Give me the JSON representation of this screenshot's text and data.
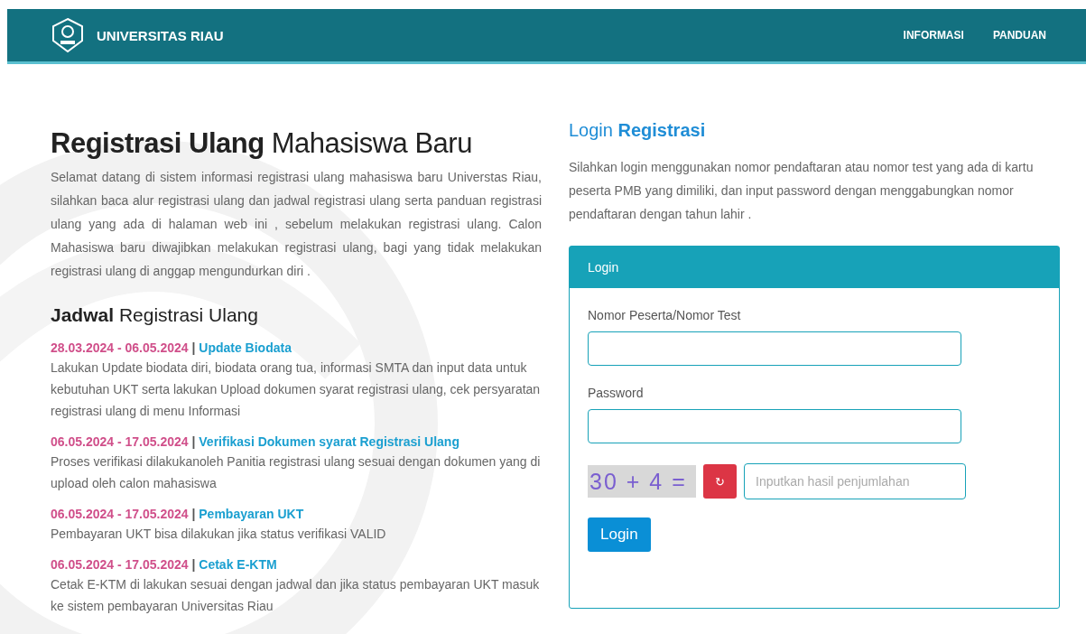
{
  "header": {
    "title": "UNIVERSITAS RIAU",
    "nav": [
      {
        "label": "INFORMASI"
      },
      {
        "label": "PANDUAN"
      }
    ]
  },
  "intro": {
    "title_bold": "Registrasi Ulang",
    "title_rest": "Mahasiswa Baru",
    "text": "Selamat datang di sistem informasi registrasi ulang mahasiswa baru Universtas Riau, silahkan baca alur registrasi ulang dan jadwal registrasi ulang serta panduan registrasi ulang yang ada di halaman web ini , sebelum melakukan registrasi ulang. Calon Mahasiswa baru diwajibkan melakukan registrasi ulang, bagi yang tidak melakukan registrasi ulang di anggap mengundurkan diri ."
  },
  "schedule": {
    "title_bold": "Jadwal",
    "title_rest": "Registrasi Ulang",
    "items": [
      {
        "dates": "28.03.2024 - 06.05.2024",
        "separator": "|",
        "title": "Update Biodata",
        "text": "Lakukan Update biodata diri, biodata orang tua, informasi SMTA dan input data untuk kebutuhan UKT serta lakukan Upload dokumen syarat registrasi ulang, cek persyaratan registrasi ulang di menu Informasi"
      },
      {
        "dates": "06.05.2024 - 17.05.2024",
        "separator": "|",
        "title": "Verifikasi Dokumen syarat Registrasi Ulang",
        "text": "Proses verifikasi dilakukanoleh Panitia registrasi ulang sesuai dengan dokumen yang di upload oleh calon mahasiswa"
      },
      {
        "dates": "06.05.2024 - 17.05.2024",
        "separator": "|",
        "title": "Pembayaran UKT",
        "text": "Pembayaran UKT bisa dilakukan jika status verifikasi VALID"
      },
      {
        "dates": "06.05.2024 - 17.05.2024",
        "separator": "|",
        "title": "Cetak E-KTM",
        "text": "Cetak E-KTM di lakukan sesuai dengan jadwal dan jika status pembayaran UKT masuk ke sistem pembayaran Universitas Riau"
      }
    ]
  },
  "login": {
    "title_plain": "Login",
    "title_bold": "Registrasi",
    "text": "Silahkan login menggunakan nomor pendaftaran atau nomor test yang ada di kartu peserta PMB yang dimiliki, dan input password dengan menggabungkan nomor pendaftaran dengan tahun lahir .",
    "card_title": "Login",
    "fields": [
      {
        "label": "Nomor Peserta/Nomor Test"
      },
      {
        "label": "Password"
      }
    ],
    "captcha": {
      "text": "30 + 4 =",
      "refresh": "↻",
      "placeholder": "Inputkan hasil penjumlahan"
    },
    "button": "Login"
  }
}
